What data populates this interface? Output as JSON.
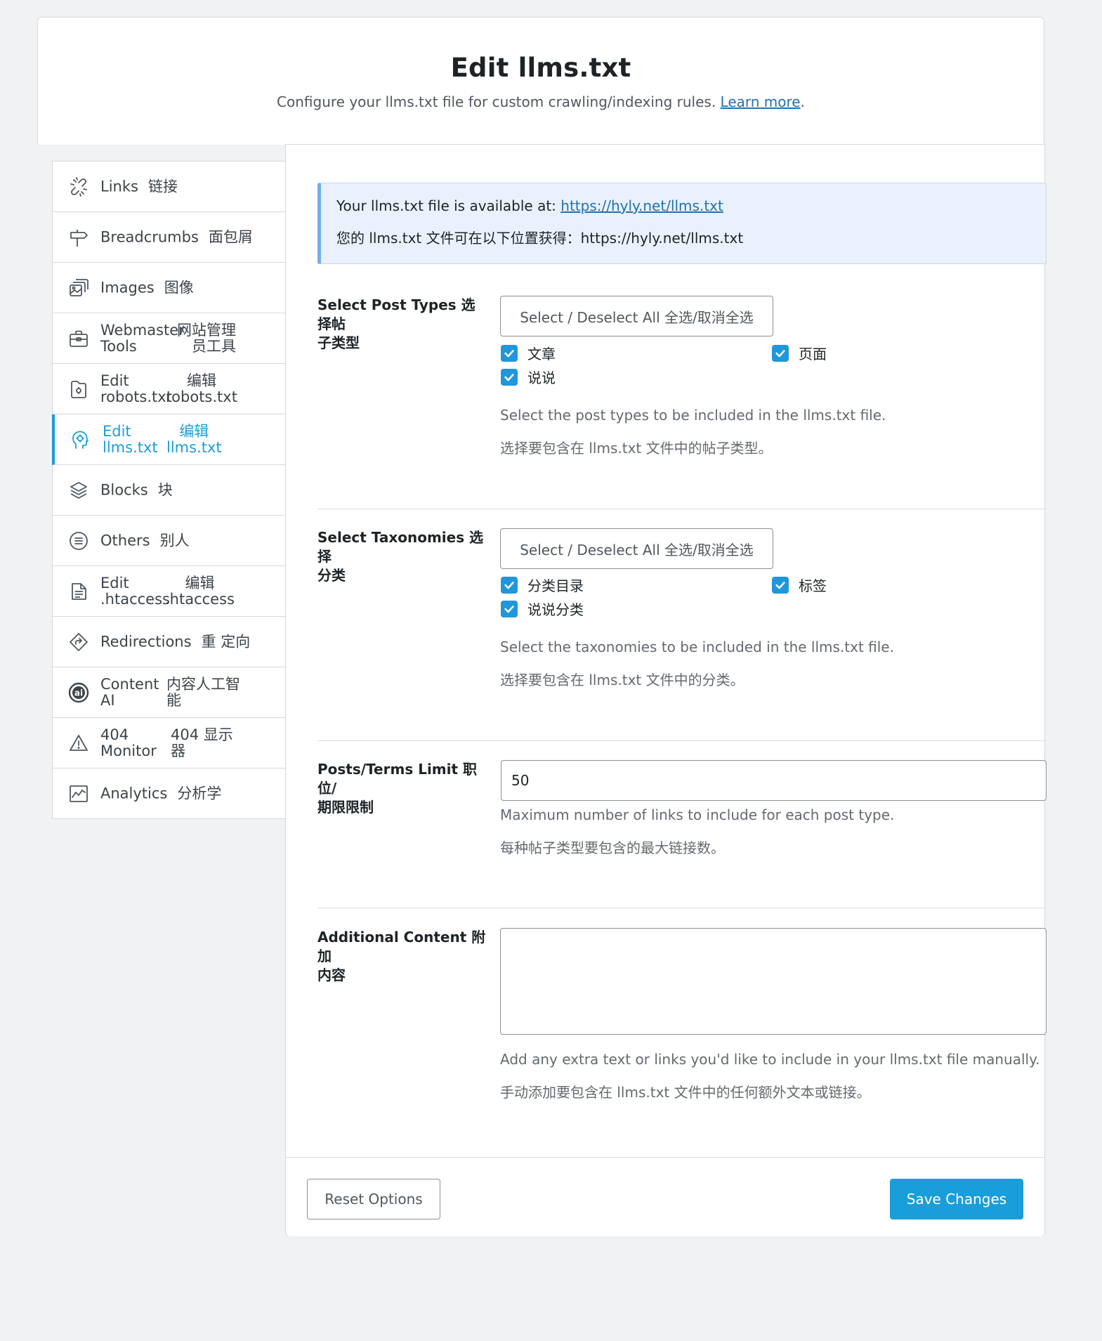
{
  "header": {
    "title": "Edit llms.txt",
    "subtitle": "Configure your llms.txt file for custom crawling/indexing rules.",
    "learn_more": "Learn more",
    "period": "."
  },
  "sidebar": {
    "items": [
      {
        "en": "Links",
        "cn": "链接",
        "icon": "link-broken-icon"
      },
      {
        "en": "Breadcrumbs",
        "cn": "面包屑",
        "icon": "signpost-icon"
      },
      {
        "en": "Images",
        "cn": "图像",
        "icon": "images-icon"
      },
      {
        "en": "Webmaster Tools",
        "cn": "网站管理员工具",
        "icon": "toolbox-icon"
      },
      {
        "en": "Edit robots.txt",
        "cn": "编辑 robots.txt",
        "icon": "robot-file-icon"
      },
      {
        "en": "Edit llms.txt",
        "cn": "编辑 llms.txt",
        "icon": "ai-head-icon",
        "active": true
      },
      {
        "en": "Blocks",
        "cn": "块",
        "icon": "blocks-icon"
      },
      {
        "en": "Others",
        "cn": "别人",
        "icon": "list-circle-icon"
      },
      {
        "en": "Edit .htaccess",
        "cn": "编辑 .htaccess",
        "icon": "file-lines-icon"
      },
      {
        "en": "Redirections",
        "cn": "重 定向",
        "icon": "redirect-icon"
      },
      {
        "en": "Content AI",
        "cn": "内容人工智能",
        "icon": "content-ai-icon"
      },
      {
        "en": "404 Monitor",
        "cn": "404 显示器",
        "icon": "warning-icon"
      },
      {
        "en": "Analytics",
        "cn": "分析学",
        "icon": "analytics-icon"
      }
    ],
    "two_line": {
      "webmaster": {
        "en1": "Webmaster",
        "en2": "Tools",
        "cn1": "网站管理",
        "cn2": "员工具"
      },
      "robots": {
        "en1": "Edit",
        "en2": "robots.txt",
        "cn1": "编辑",
        "cn2": "robots.txt"
      },
      "llms": {
        "en1": "Edit",
        "en2": "llms.txt",
        "cn1": "编辑",
        "cn2": "llms.txt"
      },
      "htaccess": {
        "en1": "Edit",
        "en2": ".htaccess",
        "cn1": "编辑",
        "cn2": ".htaccess"
      },
      "contentai": {
        "en1": "Content",
        "en2": "AI",
        "cn1": "内容人工智",
        "cn2": "能"
      },
      "monitor": {
        "en1": "404",
        "en2": "Monitor",
        "cn1": "404 显示",
        "cn2": "器"
      }
    }
  },
  "notice": {
    "line1_prefix": "Your llms.txt file is available at:",
    "url": "https://hyly.net/llms.txt",
    "line2": "您的 llms.txt 文件可在以下位置获得：https://hyly.net/llms.txt"
  },
  "post_types": {
    "label_line1": "Select Post Types 选择帖",
    "label_line2": "子类型",
    "select_all": "Select / Deselect All 全选/取消全选",
    "options": [
      {
        "label": "文章",
        "checked": true
      },
      {
        "label": "页面",
        "checked": true
      },
      {
        "label": "说说",
        "checked": true
      }
    ],
    "hint_en": "Select the post types to be included in the llms.txt file.",
    "hint_cn": "选择要包含在 llms.txt 文件中的帖子类型。"
  },
  "taxonomies": {
    "label_line1": "Select Taxonomies 选择",
    "label_line2": "分类",
    "select_all": "Select / Deselect All 全选/取消全选",
    "options": [
      {
        "label": "分类目录",
        "checked": true
      },
      {
        "label": "标签",
        "checked": true
      },
      {
        "label": "说说分类",
        "checked": true
      }
    ],
    "hint_en": "Select the taxonomies to be included in the llms.txt file.",
    "hint_cn": "选择要包含在 llms.txt 文件中的分类。"
  },
  "limit": {
    "label_line1": "Posts/Terms Limit 职位/",
    "label_line2": "期限限制",
    "value": "50",
    "hint_en": "Maximum number of links to include for each post type.",
    "hint_cn": "每种帖子类型要包含的最大链接数。"
  },
  "additional": {
    "label_line1": "Additional Content 附加",
    "label_line2": "内容",
    "value": "",
    "hint_en": "Add any extra text or links you'd like to include in your llms.txt file manually.",
    "hint_cn": "手动添加要包含在 llms.txt 文件中的任何额外文本或链接。"
  },
  "footer": {
    "reset": "Reset Options",
    "save": "Save Changes"
  },
  "colors": {
    "accent": "#1a9ed9",
    "checkbox": "#2196d8",
    "notice_bg": "#eaf1fc",
    "notice_border": "#72aee6"
  }
}
